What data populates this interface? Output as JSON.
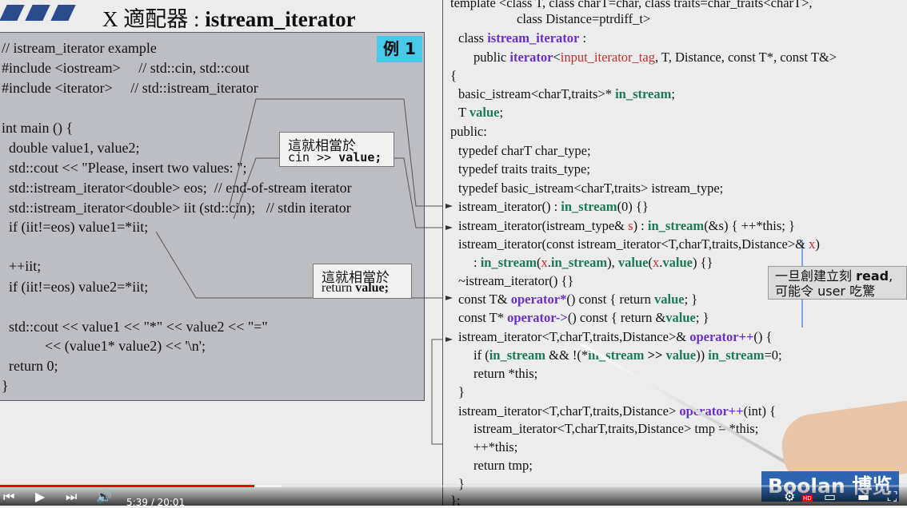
{
  "slide": {
    "title_prefix": "X 適配器 : ",
    "title_main": "istream_iterator",
    "badge": "例 1"
  },
  "left_code": [
    "// istream_iterator example",
    "#include <iostream>     // std::cin, std::cout",
    "#include <iterator>     // std::istream_iterator",
    "",
    "int main () {",
    "  double value1, value2;",
    "  std::cout << \"Please, insert two values: \";",
    "  std::istream_iterator<double> eos;  // end-of-stream iterator",
    "  std::istream_iterator<double> iit (std::cin);   // stdin iterator",
    "  if (iit!=eos) value1=*iit;",
    "",
    "  ++iit;",
    "  if (iit!=eos) value2=*iit;",
    "",
    "  std::cout << value1 << \"*\" << value2 << \"=\"",
    "            << (value1* value2) << '\\n';",
    "  return 0;",
    "}"
  ],
  "callouts": {
    "first_label": "這就相當於",
    "first_code_a": "cin >> ",
    "first_code_b": "value;",
    "second_label": "這就相當於",
    "second_code_a": "return ",
    "second_code_b": "value;"
  },
  "right_code": {
    "l0": "template <class T, class charT=char, class traits=char_traits<charT>,",
    "l1": "class Distance=ptrdiff_t>",
    "l2a": "class ",
    "l2b": "istream_iterator",
    "l2c": " :",
    "l3a": "public ",
    "l3b": "iterator",
    "l3c": "<",
    "l3d": "input_iterator_tag",
    "l3e": ", T, Distance, const T*, const T&>",
    "l4": "{",
    "l5a": "basic_istream<charT,traits>* ",
    "l5b": "in_stream",
    "l5c": ";",
    "l6a": "T ",
    "l6b": "value",
    "l6c": ";",
    "l7": "public:",
    "l8": "typedef charT char_type;",
    "l9": "typedef traits traits_type;",
    "l10": "typedef basic_istream<charT,traits> istream_type;",
    "l11a": "istream_iterator() : ",
    "l11b": "in_stream",
    "l11c": "(0) {}",
    "l12a": "istream_iterator(istream_type& ",
    "l12b": "s",
    "l12c": ") : ",
    "l12d": "in_stream",
    "l12e": "(&s) { ++*this; }",
    "l13a": "istream_iterator(const istream_iterator<T,charT,traits,Distance>& ",
    "l13b": "x",
    "l13c": ")",
    "l14a": ": ",
    "l14b": "in_stream",
    "l14c": "(",
    "l14d": "x",
    "l14e": ".",
    "l14f": "in_stream",
    "l14g": "), ",
    "l14h": "value",
    "l14i": "(",
    "l14j": "x",
    "l14k": ".",
    "l14l": "value",
    "l14m": ") {}",
    "l15": "~istream_iterator() {}",
    "l16a": "const T& ",
    "l16b": "operator*",
    "l16c": "() const { return ",
    "l16d": "value",
    "l16e": "; }",
    "l17a": "const T* ",
    "l17b": "operator->",
    "l17c": "() const { return &",
    "l17d": "value",
    "l17e": "; }",
    "l18a": "istream_iterator<T,charT,traits,Distance>& ",
    "l18b": "operator++",
    "l18c": "() {",
    "l19a": "if (",
    "l19b": "in_stream",
    "l19c": " && !(*",
    "l19d": "in_stream",
    "l19e": " >> ",
    "l19f": "value",
    "l19g": ")) ",
    "l19h": "in_stream",
    "l19i": "=0;",
    "l20": "return *this;",
    "l21": "}",
    "l22a": "istream_iterator<T,charT,traits,Distance> ",
    "l22b": "operator++",
    "l22c": "(int) {",
    "l23": "istream_iterator<T,charT,traits,Distance> tmp = *this;",
    "l24": "++*this;",
    "l25": "return tmp;",
    "l26": "}",
    "l27": "};"
  },
  "note": {
    "line1a": "一旦創建立刻 ",
    "line1b": "read",
    "line1c": ",",
    "line2": "可能令 user 吃驚"
  },
  "logo": "Boolan 博览",
  "player": {
    "time": "5:39 / 20:01",
    "progress": 0.28,
    "buffered": 0.31,
    "hd": "HD",
    "colors": {
      "played": "#ee0000",
      "code_keyword": "#6a2fc6",
      "code_member": "#1b7a55",
      "badge": "#49c8e8"
    }
  }
}
